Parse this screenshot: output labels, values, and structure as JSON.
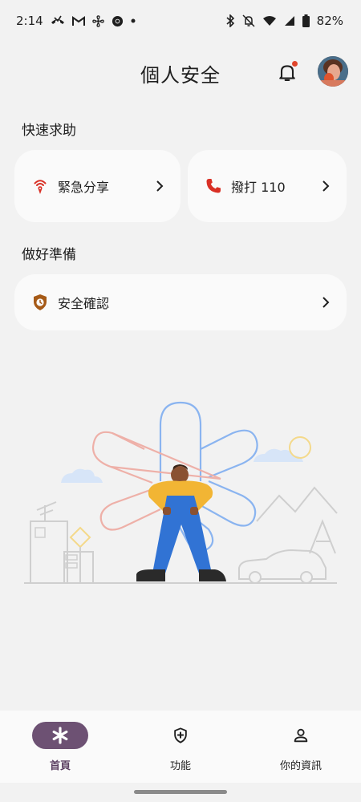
{
  "status_bar": {
    "time": "2:14",
    "battery": "82%",
    "left_icons": [
      "missed-call-icon",
      "gmail-icon",
      "fan-icon",
      "chrome-icon",
      "dot-icon"
    ],
    "right_icons": [
      "bluetooth-icon",
      "mute-icon",
      "wifi-icon",
      "signal-icon",
      "battery-icon"
    ]
  },
  "header": {
    "title": "個人安全",
    "notification_dot_color": "#e0452b"
  },
  "quick_help": {
    "heading": "快速求助",
    "items": [
      {
        "label": "緊急分享",
        "icon": "emergency-share-icon",
        "icon_color": "#d93025"
      },
      {
        "label": "撥打 110",
        "icon": "phone-icon",
        "icon_color": "#d93025"
      }
    ]
  },
  "prepare": {
    "heading": "做好準備",
    "items": [
      {
        "label": "安全確認",
        "icon": "safety-check-shield-icon",
        "icon_color": "#a65a17"
      }
    ]
  },
  "bottom_nav": {
    "items": [
      {
        "label": "首頁",
        "icon": "asterisk-icon",
        "active": true
      },
      {
        "label": "功能",
        "icon": "shield-plus-icon",
        "active": false
      },
      {
        "label": "你的資訊",
        "icon": "person-icon",
        "active": false
      }
    ],
    "active_color": "#6d5173"
  }
}
